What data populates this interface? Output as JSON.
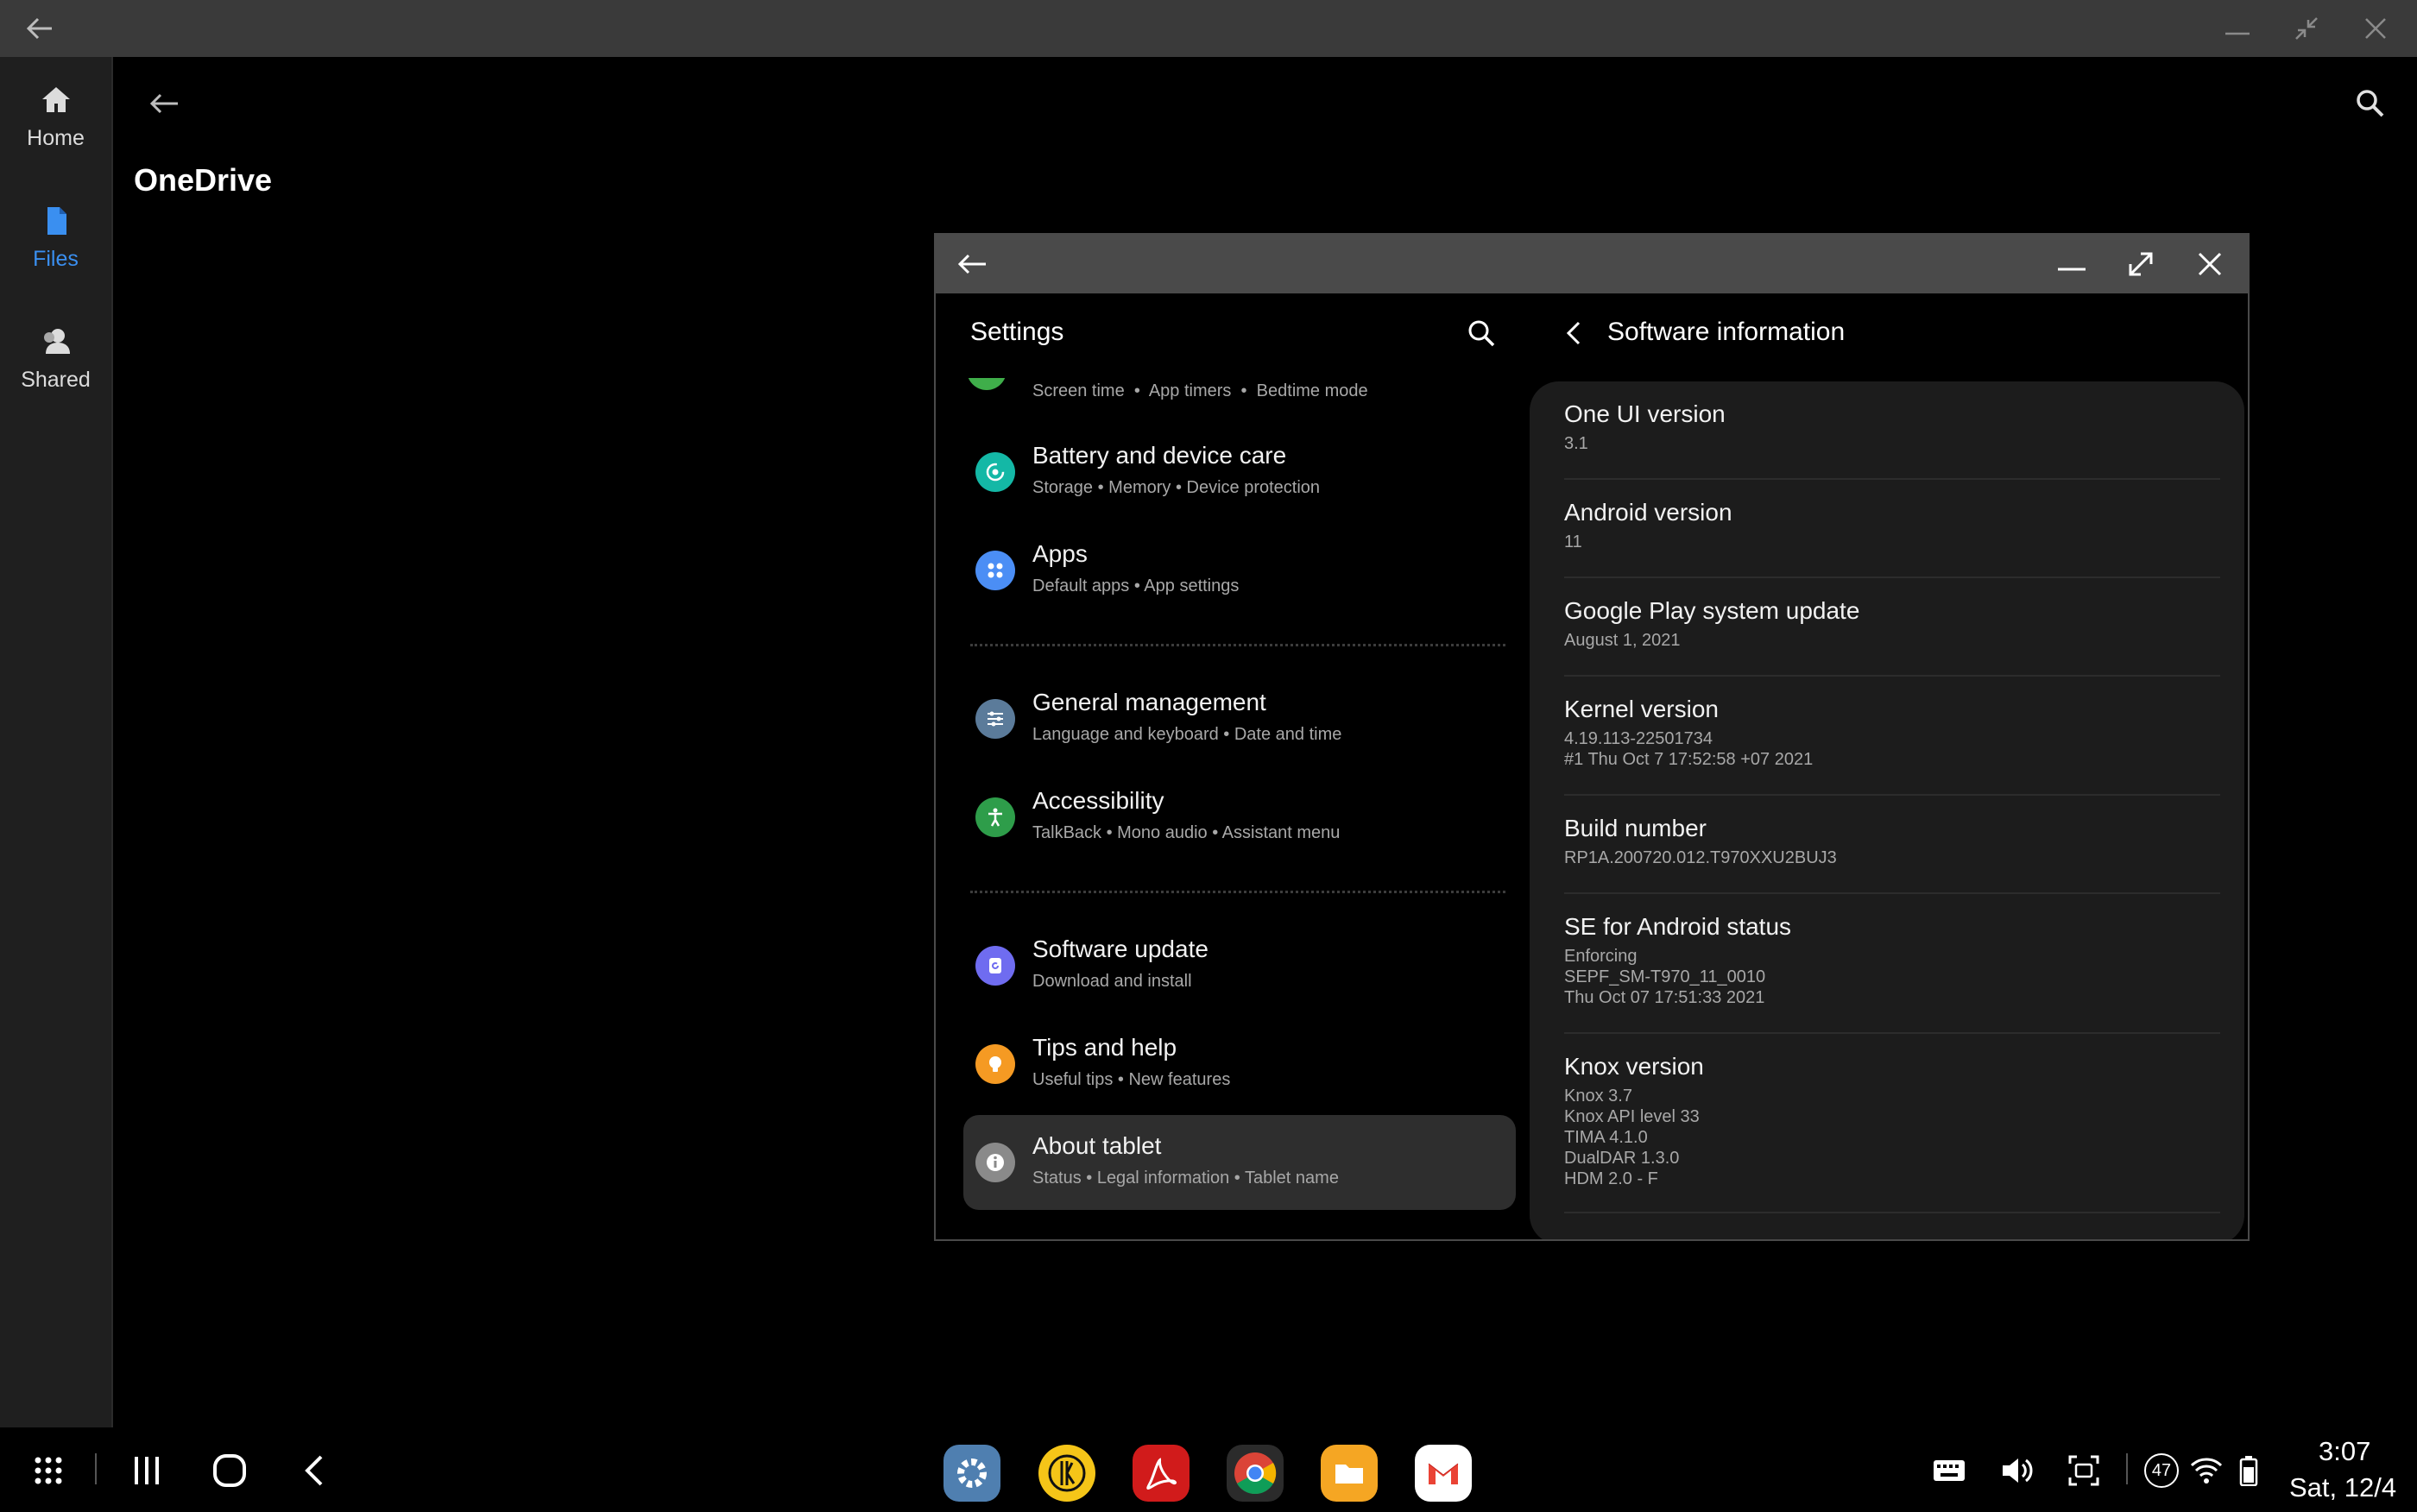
{
  "window": {
    "icons": [
      "back-arrow-icon",
      "minimize-icon",
      "restore-icon",
      "close-icon"
    ]
  },
  "onedrive": {
    "title": "OneDrive",
    "nav": [
      {
        "label": "Home",
        "icon": "home-icon"
      },
      {
        "label": "Files",
        "icon": "file-icon",
        "active": true
      },
      {
        "label": "Shared",
        "icon": "people-icon"
      }
    ]
  },
  "settings": {
    "title": "Settings",
    "partial_item": {
      "subtitle_parts": [
        "Screen time",
        "App timers",
        "Bedtime mode"
      ]
    },
    "items": [
      {
        "title": "Battery and device care",
        "subtitle": "Storage  •  Memory  •  Device protection",
        "icon": "device-care-icon",
        "color": "#14b8a6"
      },
      {
        "title": "Apps",
        "subtitle": "Default apps  •  App settings",
        "icon": "apps-grid-icon",
        "color": "#4b8ef5"
      },
      {
        "title": "General management",
        "subtitle": "Language and keyboard  •  Date and time",
        "icon": "sliders-icon",
        "color": "#5b7b9a"
      },
      {
        "title": "Accessibility",
        "subtitle": "TalkBack  •  Mono audio  •  Assistant menu",
        "icon": "accessibility-icon",
        "color": "#2e9d4a"
      },
      {
        "title": "Software update",
        "subtitle": "Download and install",
        "icon": "software-update-icon",
        "color": "#6f6cf0"
      },
      {
        "title": "Tips and help",
        "subtitle": "Useful tips  •  New features",
        "icon": "lightbulb-icon",
        "color": "#f59a23"
      },
      {
        "title": "About tablet",
        "subtitle": "Status  •  Legal information  •  Tablet name",
        "icon": "info-icon",
        "color": "#8a8a8a",
        "selected": true
      }
    ]
  },
  "software_info": {
    "title": "Software information",
    "entries": [
      {
        "title": "One UI version",
        "value": "3.1"
      },
      {
        "title": "Android version",
        "value": "11"
      },
      {
        "title": "Google Play system update",
        "value": "August 1, 2021"
      },
      {
        "title": "Kernel version",
        "value": "4.19.113-22501734\n#1 Thu Oct 7 17:52:58 +07 2021"
      },
      {
        "title": "Build number",
        "value": "RP1A.200720.012.T970XXU2BUJ3"
      },
      {
        "title": "SE for Android status",
        "value": "Enforcing\nSEPF_SM-T970_11_0010\nThu Oct 07 17:51:33 2021"
      },
      {
        "title": "Knox version",
        "value": "Knox 3.7\nKnox API level 33\nTIMA 4.1.0\nDualDAR 1.3.0\nHDM 2.0 - F"
      }
    ]
  },
  "taskbar": {
    "nav_icons": [
      "app-drawer-icon",
      "recents-icon",
      "home-circle-icon",
      "back-chevron-icon"
    ],
    "apps": [
      {
        "name": "settings-app-icon",
        "color": "#4f7fb0"
      },
      {
        "name": "keeper-app-icon",
        "color": "#f5c518"
      },
      {
        "name": "acrobat-app-icon",
        "color": "#d11b1b"
      },
      {
        "name": "chrome-app-icon",
        "color": "#2b2b2b"
      },
      {
        "name": "my-files-app-icon",
        "color": "#f5a623"
      },
      {
        "name": "gmail-app-icon",
        "color": "#ffffff"
      }
    ],
    "notification_count": "47",
    "time": "3:07",
    "date": "Sat, 12/4"
  }
}
